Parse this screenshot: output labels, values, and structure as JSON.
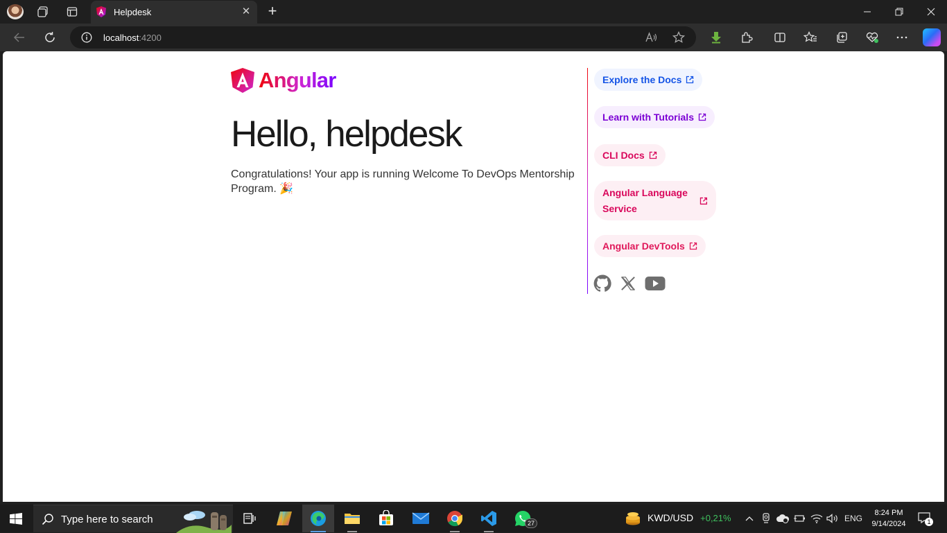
{
  "browser": {
    "tab_title": "Helpdesk",
    "new_tab_symbol": "+",
    "url_host": "localhost",
    "url_port": ":4200"
  },
  "page": {
    "brand": "Angular",
    "title": "Hello, helpdesk",
    "message": "Congratulations! Your app is running Welcome To DevOps Mentorship Program. 🎉",
    "links": [
      {
        "label": "Explore the Docs"
      },
      {
        "label": "Learn with Tutorials"
      },
      {
        "label": "CLI Docs"
      },
      {
        "label": "Angular Language Service"
      },
      {
        "label": "Angular DevTools"
      }
    ],
    "social_icons": [
      "github-icon",
      "x-icon",
      "youtube-icon"
    ]
  },
  "taskbar": {
    "search_placeholder": "Type here to search",
    "whatsapp_badge": "27",
    "ticker_pair": "KWD/USD",
    "ticker_change": "+0,21%",
    "language": "ENG",
    "time": "8:24 PM",
    "date": "9/14/2024",
    "notification_count": "1"
  },
  "colors": {
    "angular_red": "#f0060b",
    "angular_purple": "#7702ff",
    "docs_blue": "#1454e6",
    "tutorial_purple": "#7b00d4",
    "pink": "#d9075b",
    "ticker_green": "#3fc15e"
  }
}
